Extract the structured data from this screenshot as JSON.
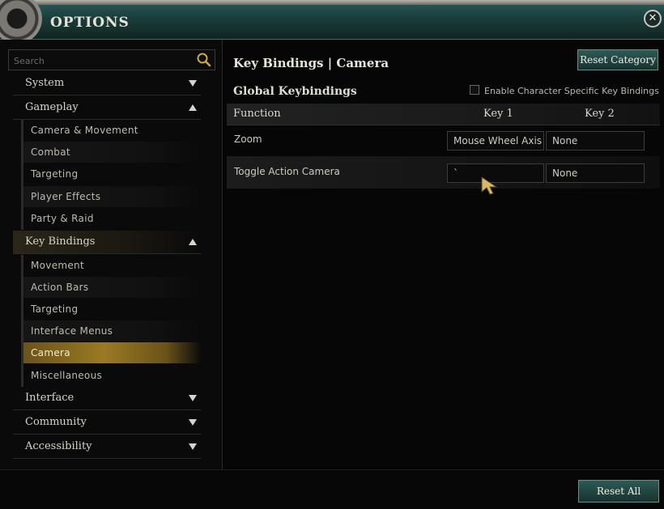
{
  "window": {
    "title": "Options",
    "close_symbol": "✕"
  },
  "search": {
    "placeholder": "Search"
  },
  "sidebar": {
    "categories": [
      {
        "label": "System",
        "expanded": false
      },
      {
        "label": "Gameplay",
        "expanded": true,
        "items": [
          "Camera & Movement",
          "Combat",
          "Targeting",
          "Player Effects",
          "Party & Raid"
        ]
      },
      {
        "label": "Key Bindings",
        "expanded": true,
        "items": [
          "Movement",
          "Action Bars",
          "Targeting",
          "Interface Menus",
          "Camera",
          "Miscellaneous"
        ],
        "selected": "Camera"
      },
      {
        "label": "Interface",
        "expanded": false
      },
      {
        "label": "Community",
        "expanded": false
      },
      {
        "label": "Accessibility",
        "expanded": false
      }
    ]
  },
  "main": {
    "heading": "Key Bindings | Camera",
    "reset_category_label": "Reset Category",
    "subheading": "Global Keybindings",
    "character_specific_label": "Enable Character Specific Key Bindings",
    "character_specific_checked": false,
    "columns": {
      "function": "Function",
      "key1": "Key 1",
      "key2": "Key 2"
    },
    "rows": [
      {
        "function": "Zoom",
        "key1": "Mouse Wheel Axis",
        "key2": "None"
      },
      {
        "function": "Toggle Action Camera",
        "key1": "`",
        "key2": "None"
      }
    ]
  },
  "footer": {
    "reset_all_label": "Reset All"
  },
  "colors": {
    "accent_teal": "#2e5a56",
    "selected_gold": "#9a7a24",
    "background": "#050505"
  }
}
